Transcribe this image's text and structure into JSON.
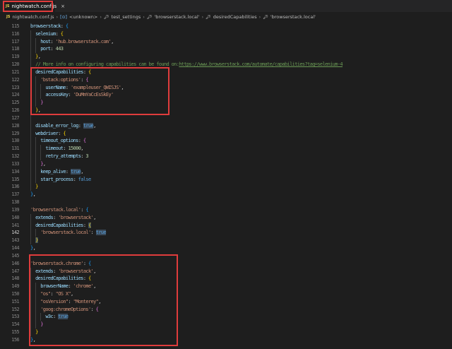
{
  "tab": {
    "icon": "js-file-icon",
    "label": "nightwatch.conf.js",
    "close": "×"
  },
  "breadcrumb": [
    "nightwatch.conf.js",
    "<unknown>",
    "test_settings",
    "'browserstack.local'",
    "desiredCapabilities",
    "'browserstack.local'"
  ],
  "colors": {
    "key": "#9cdcfe",
    "string": "#ce9178",
    "number": "#b5cea8",
    "keyword": "#569cd6",
    "comment": "#6a9955",
    "highlight_box": "#e03c3c"
  },
  "current_line": 142,
  "lines": [
    {
      "n": 115,
      "i": 1,
      "t": [
        [
          "k",
          "browserstack"
        ],
        [
          "",
          "‌: "
        ],
        [
          "bl",
          "{"
        ]
      ]
    },
    {
      "n": 116,
      "i": 2,
      "t": [
        [
          "k",
          "selenium"
        ],
        [
          "",
          ": "
        ],
        [
          "y",
          "{"
        ]
      ]
    },
    {
      "n": 117,
      "i": 3,
      "t": [
        [
          "k",
          "host"
        ],
        [
          "",
          ": "
        ],
        [
          "s",
          "'hub.browserstack.com'"
        ],
        [
          "",
          ","
        ]
      ]
    },
    {
      "n": 118,
      "i": 3,
      "t": [
        [
          "k",
          "port"
        ],
        [
          "",
          ": "
        ],
        [
          "n",
          "443"
        ]
      ]
    },
    {
      "n": 119,
      "i": 2,
      "t": [
        [
          "y",
          "}"
        ],
        [
          "",
          ","
        ]
      ]
    },
    {
      "n": 120,
      "i": 2,
      "t": [
        [
          "c",
          "// More info on configuring capabilities can be found on:"
        ],
        [
          "u",
          "https://www.browserstack.com/automate/capabilities?tag=selenium-4"
        ]
      ]
    },
    {
      "n": 121,
      "i": 2,
      "t": [
        [
          "k",
          "desiredCapabilities"
        ],
        [
          "",
          ": "
        ],
        [
          "y",
          "{"
        ]
      ]
    },
    {
      "n": 122,
      "i": 3,
      "t": [
        [
          "s",
          "'bstack:options'"
        ],
        [
          "",
          ": "
        ],
        [
          "p",
          "{"
        ]
      ]
    },
    {
      "n": 123,
      "i": 4,
      "t": [
        [
          "k",
          "userName"
        ],
        [
          "",
          ": "
        ],
        [
          "s",
          "'exampleuser_QWISJS'"
        ],
        [
          "",
          ","
        ]
      ]
    },
    {
      "n": 124,
      "i": 4,
      "t": [
        [
          "k",
          "accessKey"
        ],
        [
          "",
          ": "
        ],
        [
          "s",
          "'DuMmYaCcEsSkEy'"
        ]
      ]
    },
    {
      "n": 125,
      "i": 3,
      "t": [
        [
          "p",
          "}"
        ]
      ]
    },
    {
      "n": 126,
      "i": 2,
      "t": [
        [
          "y",
          "}"
        ],
        [
          "",
          ","
        ]
      ]
    },
    {
      "n": 127,
      "i": 2,
      "t": []
    },
    {
      "n": 128,
      "i": 2,
      "t": [
        [
          "k",
          "disable_error_log"
        ],
        [
          "",
          ": "
        ],
        [
          "b hl",
          "true"
        ],
        [
          "",
          ","
        ]
      ]
    },
    {
      "n": 129,
      "i": 2,
      "t": [
        [
          "k",
          "webdriver"
        ],
        [
          "",
          ": "
        ],
        [
          "y",
          "{"
        ]
      ]
    },
    {
      "n": 130,
      "i": 3,
      "t": [
        [
          "k",
          "timeout_options"
        ],
        [
          "",
          ": "
        ],
        [
          "p",
          "{"
        ]
      ]
    },
    {
      "n": 131,
      "i": 4,
      "t": [
        [
          "k",
          "timeout"
        ],
        [
          "",
          ": "
        ],
        [
          "n",
          "15000"
        ],
        [
          "",
          ","
        ]
      ]
    },
    {
      "n": 132,
      "i": 4,
      "t": [
        [
          "k",
          "retry_attempts"
        ],
        [
          "",
          ": "
        ],
        [
          "n",
          "3"
        ]
      ]
    },
    {
      "n": 133,
      "i": 3,
      "t": [
        [
          "p",
          "}"
        ],
        [
          "",
          ","
        ]
      ]
    },
    {
      "n": 134,
      "i": 3,
      "t": [
        [
          "k",
          "keep_alive"
        ],
        [
          "",
          ": "
        ],
        [
          "b hl",
          "true"
        ],
        [
          "",
          ","
        ]
      ]
    },
    {
      "n": 135,
      "i": 3,
      "t": [
        [
          "k",
          "start_process"
        ],
        [
          "",
          ": "
        ],
        [
          "b",
          "false"
        ]
      ]
    },
    {
      "n": 136,
      "i": 2,
      "t": [
        [
          "y",
          "}"
        ]
      ]
    },
    {
      "n": 137,
      "i": 1,
      "t": [
        [
          "bl",
          "}"
        ],
        [
          "",
          ","
        ]
      ]
    },
    {
      "n": 138,
      "i": 1,
      "t": []
    },
    {
      "n": 139,
      "i": 1,
      "t": [
        [
          "s",
          "'browserstack.local'"
        ],
        [
          "",
          ": "
        ],
        [
          "bl",
          "{"
        ]
      ]
    },
    {
      "n": 140,
      "i": 2,
      "t": [
        [
          "k",
          "extends"
        ],
        [
          "",
          ": "
        ],
        [
          "s",
          "'browserstack'"
        ],
        [
          "",
          ","
        ]
      ]
    },
    {
      "n": 141,
      "i": 2,
      "t": [
        [
          "k",
          "desiredCapabilities"
        ],
        [
          "",
          ": "
        ],
        [
          "y hl",
          "{"
        ]
      ]
    },
    {
      "n": 142,
      "i": 3,
      "t": [
        [
          "s",
          "'browserstack.local'"
        ],
        [
          "",
          ": "
        ],
        [
          "b hl",
          "true"
        ]
      ]
    },
    {
      "n": 143,
      "i": 2,
      "t": [
        [
          "y hl",
          "}"
        ]
      ]
    },
    {
      "n": 144,
      "i": 1,
      "t": [
        [
          "bl",
          "}"
        ],
        [
          "",
          ","
        ]
      ]
    },
    {
      "n": 145,
      "i": 1,
      "t": []
    },
    {
      "n": 146,
      "i": 1,
      "t": [
        [
          "s",
          "'browserstack.chrome'"
        ],
        [
          "",
          ": "
        ],
        [
          "bl",
          "{"
        ]
      ]
    },
    {
      "n": 147,
      "i": 2,
      "t": [
        [
          "k",
          "extends"
        ],
        [
          "",
          ": "
        ],
        [
          "s",
          "'browserstack'"
        ],
        [
          "",
          ","
        ]
      ]
    },
    {
      "n": 148,
      "i": 2,
      "t": [
        [
          "k",
          "desiredCapabilities"
        ],
        [
          "",
          ": "
        ],
        [
          "y",
          "{"
        ]
      ]
    },
    {
      "n": 149,
      "i": 3,
      "t": [
        [
          "k",
          "browserName"
        ],
        [
          "",
          ": "
        ],
        [
          "s",
          "'chrome'"
        ],
        [
          "",
          ","
        ]
      ]
    },
    {
      "n": 150,
      "i": 3,
      "t": [
        [
          "s",
          "\"os\""
        ],
        [
          "",
          ": "
        ],
        [
          "s",
          "\"OS X\""
        ],
        [
          "",
          ","
        ]
      ]
    },
    {
      "n": 151,
      "i": 3,
      "t": [
        [
          "s",
          "\"osVersion\""
        ],
        [
          "",
          ": "
        ],
        [
          "s",
          "\"Monterey\""
        ],
        [
          "",
          ","
        ]
      ]
    },
    {
      "n": 152,
      "i": 3,
      "t": [
        [
          "s",
          "'goog:chromeOptions'"
        ],
        [
          "",
          ": "
        ],
        [
          "p",
          "{"
        ]
      ]
    },
    {
      "n": 153,
      "i": 4,
      "t": [
        [
          "k",
          "w3c"
        ],
        [
          "",
          ": "
        ],
        [
          "b hl",
          "true"
        ]
      ]
    },
    {
      "n": 154,
      "i": 3,
      "t": [
        [
          "p",
          "}"
        ]
      ]
    },
    {
      "n": 155,
      "i": 2,
      "t": [
        [
          "y",
          "}"
        ]
      ]
    },
    {
      "n": 156,
      "i": 1,
      "t": [
        [
          "bl",
          "}"
        ],
        [
          "",
          ","
        ]
      ]
    }
  ]
}
